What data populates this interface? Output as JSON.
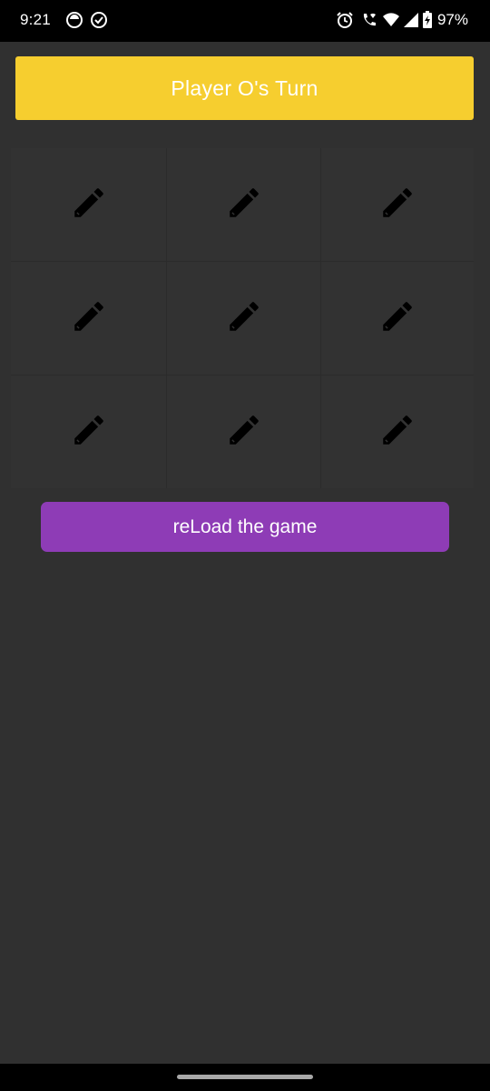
{
  "status_bar": {
    "time": "9:21",
    "battery": "97%",
    "left_icons": [
      "record-icon",
      "check-circle-icon"
    ],
    "right_icons": [
      "alarm-icon",
      "wifi-call-icon",
      "wifi-icon",
      "signal-icon",
      "battery-charging-icon"
    ]
  },
  "game": {
    "turn_label": "Player O's Turn",
    "cells": [
      {
        "icon": "pencil-icon"
      },
      {
        "icon": "pencil-icon"
      },
      {
        "icon": "pencil-icon"
      },
      {
        "icon": "pencil-icon"
      },
      {
        "icon": "pencil-icon"
      },
      {
        "icon": "pencil-icon"
      },
      {
        "icon": "pencil-icon"
      },
      {
        "icon": "pencil-icon"
      },
      {
        "icon": "pencil-icon"
      }
    ],
    "reload_label": "reLoad the game"
  },
  "colors": {
    "background": "#303030",
    "banner": "#f6ce2f",
    "button": "#8e3cb6",
    "text": "#ffffff"
  }
}
